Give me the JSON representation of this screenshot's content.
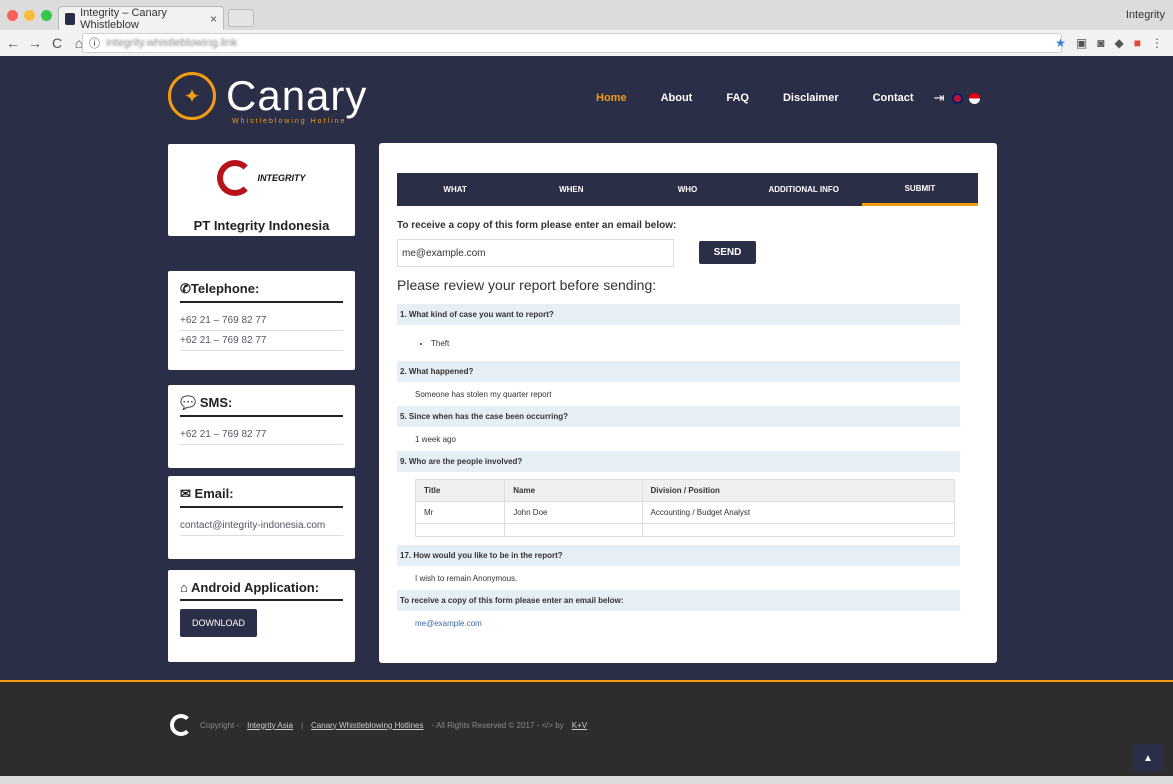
{
  "browser": {
    "tab_title": "Integrity – Canary Whistleblow",
    "profile": "Integrity",
    "url": "integrity.whistleblowing.link"
  },
  "header": {
    "brand": "Canary",
    "brand_sub": "Whistleblowing Hotline",
    "nav": [
      "Home",
      "About",
      "FAQ",
      "Disclaimer",
      "Contact"
    ]
  },
  "sidebar": {
    "company_logo_text": "INTEGRITY",
    "company_name": "PT Integrity Indonesia",
    "telephone_title": "Telephone:",
    "telephone": [
      "+62 21 – 769 82 77",
      "+62 21 – 769 82 77"
    ],
    "sms_title": "SMS:",
    "sms": "+62 21 – 769 82 77",
    "email_title": "Email:",
    "email": "contact@integrity-indonesia.com",
    "android_title": "Android Application:",
    "download": "DOWNLOAD"
  },
  "form": {
    "steps": [
      "WHAT",
      "WHEN",
      "WHO",
      "ADDITIONAL INFO",
      "SUBMIT"
    ],
    "email_label": "To receive a copy of this form please enter an email below:",
    "email_value": "me@example.com",
    "send": "SEND",
    "review_title": "Please review your report before sending:",
    "q1": "1. What kind of case you want to report?",
    "a1": "Theft",
    "q2": "2. What happened?",
    "a2": "Someone has stolen my quarter report",
    "q5": "5. Since when has the case been occurring?",
    "a5": "1 week ago",
    "q9": "9. Who are the people involved?",
    "people_headers": [
      "Title",
      "Name",
      "Division / Position"
    ],
    "people_row": [
      "Mr",
      "John Doe",
      "Accounting / Budget Analyst"
    ],
    "q17": "17. How would you like to be in the report?",
    "a17": "I wish to remain Anonymous.",
    "q_email": "To receive a copy of this form please enter an email below:",
    "a_email": "me@example.com"
  },
  "footer": {
    "copyright": "Copyright -",
    "link1": "Integrity Asia",
    "sep": "|",
    "link2": "Canary Whistleblowing Hotlines",
    "rights": "- All Rights Reserved © 2017 - </> by",
    "link3": "K+V"
  }
}
